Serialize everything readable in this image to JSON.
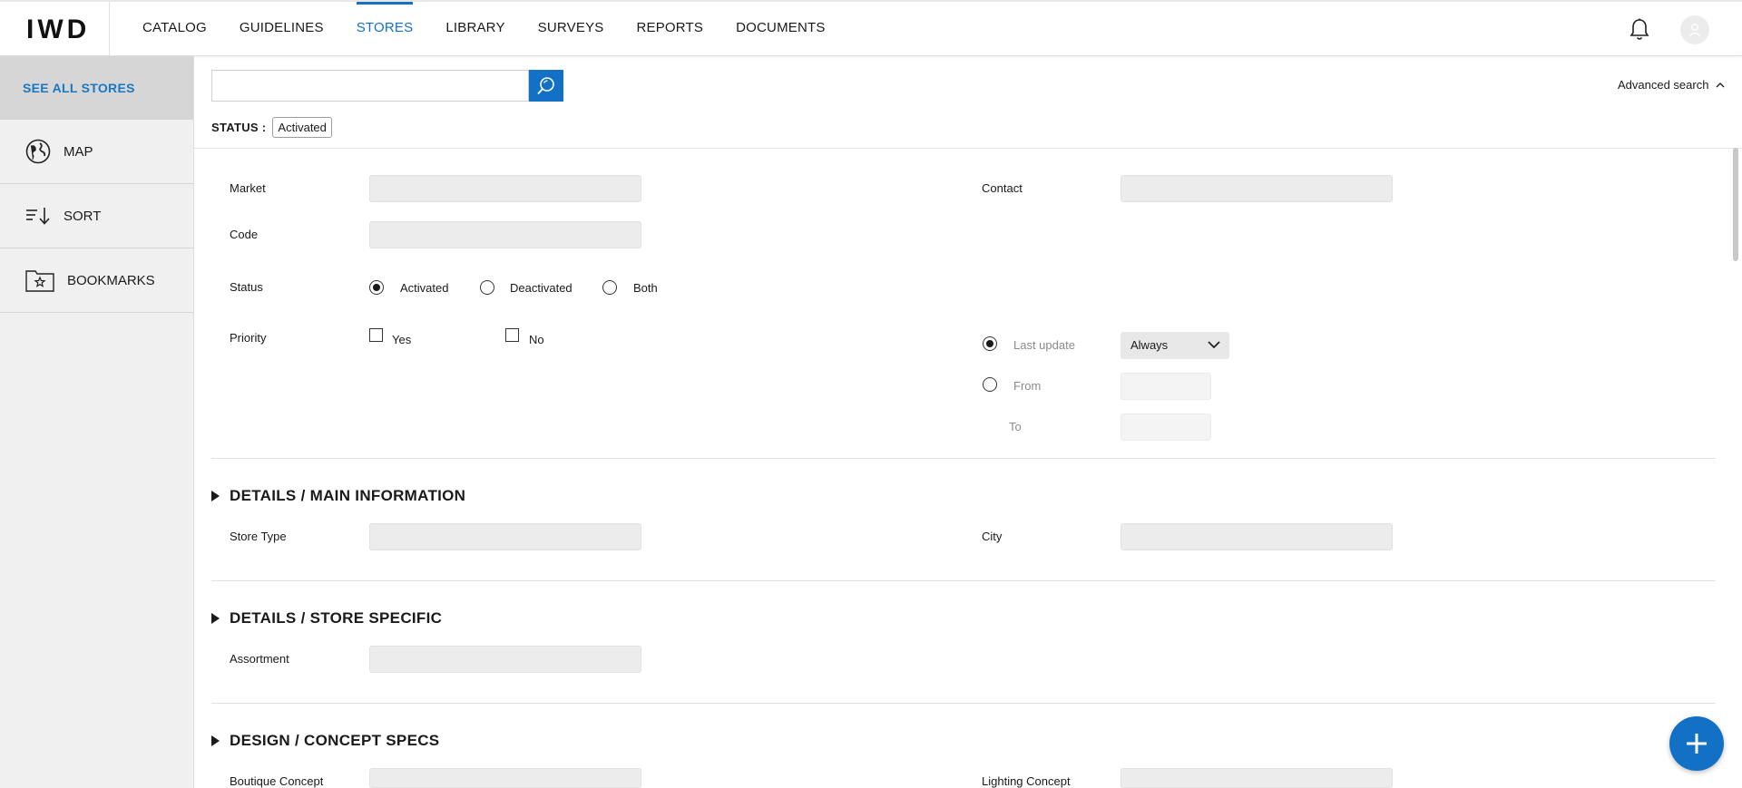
{
  "header": {
    "logo": "IWD",
    "nav": [
      "CATALOG",
      "GUIDELINES",
      "STORES",
      "LIBRARY",
      "SURVEYS",
      "REPORTS",
      "DOCUMENTS"
    ],
    "active_nav": "STORES",
    "icons": [
      "bell-icon",
      "user-avatar-icon"
    ]
  },
  "sidebar": {
    "see_all": "SEE ALL STORES",
    "items": [
      {
        "label": "MAP",
        "icon": "globe-icon"
      },
      {
        "label": "SORT",
        "icon": "sort-icon"
      },
      {
        "label": "BOOKMARKS",
        "icon": "folder-star-icon"
      }
    ]
  },
  "search": {
    "value": "",
    "placeholder": "",
    "advanced_label": "Advanced search"
  },
  "status_filter": {
    "label": "STATUS :",
    "chip": "Activated"
  },
  "form": {
    "market": "Market",
    "code": "Code",
    "status": "Status",
    "status_options": [
      "Activated",
      "Deactivated",
      "Both"
    ],
    "status_selected": "Activated",
    "priority": "Priority",
    "priority_options": [
      "Yes",
      "No"
    ],
    "contact": "Contact",
    "last_update": "Last update",
    "last_update_value": "Always",
    "from": "From",
    "to": "To"
  },
  "sections": [
    {
      "title": "DETAILS / MAIN INFORMATION",
      "fields": [
        "Store Type",
        "City"
      ]
    },
    {
      "title": "DETAILS / STORE SPECIFIC",
      "fields": [
        "Assortment"
      ]
    },
    {
      "title": "DESIGN / CONCEPT SPECS",
      "fields": [
        "Boutique Concept",
        "Lighting Concept"
      ]
    }
  ],
  "colors": {
    "accent": "#1271c4",
    "sidebar_bg": "#f0f0f0",
    "field_bg": "#ececec"
  }
}
